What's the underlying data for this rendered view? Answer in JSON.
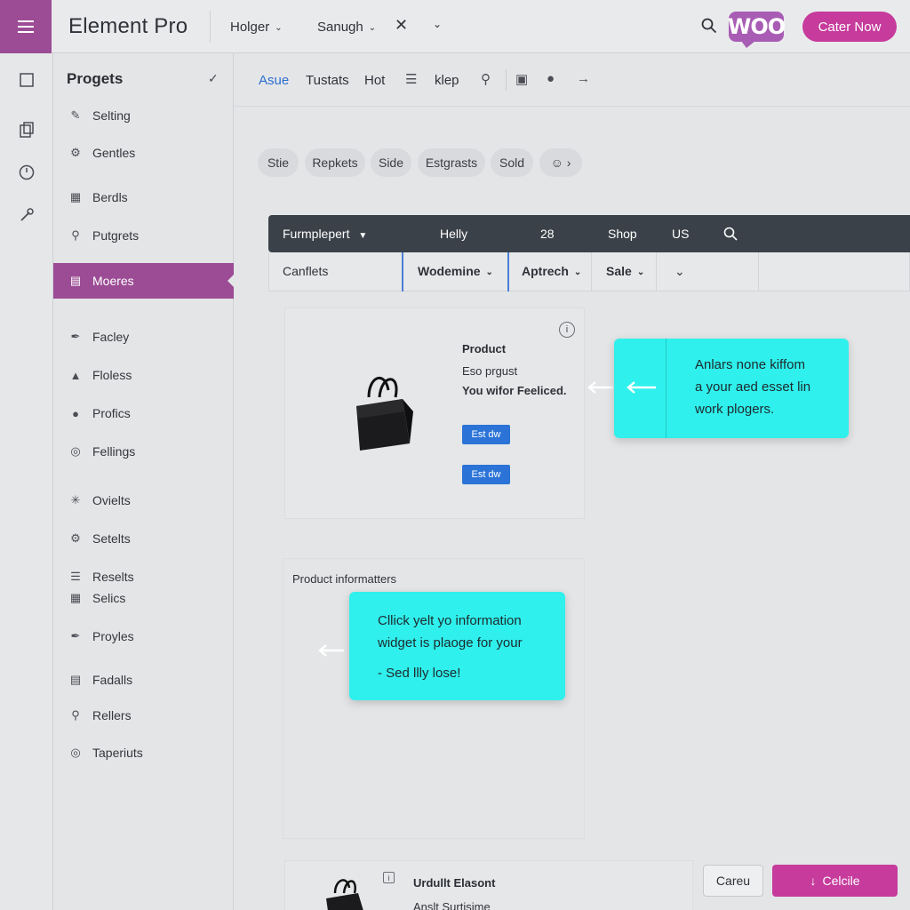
{
  "app": {
    "title": "Element Pro"
  },
  "topbar": {
    "menus": [
      "Holger",
      "Sanugh"
    ],
    "logo_text": "WOO",
    "cta_label": "Cater Now"
  },
  "sidebar": {
    "heading": "Progets",
    "items": [
      {
        "label": "Selting",
        "icon": "pencil-icon"
      },
      {
        "label": "Gentles",
        "icon": "gear-icon"
      },
      {
        "label": "Berdls",
        "icon": "grid-icon"
      },
      {
        "label": "Putgrets",
        "icon": "pin-icon"
      },
      {
        "label": "Moeres",
        "icon": "folder-icon",
        "active": true
      },
      {
        "label": "Facley",
        "icon": "brush-icon"
      },
      {
        "label": "Floless",
        "icon": "lock-icon"
      },
      {
        "label": "Profics",
        "icon": "user-icon"
      },
      {
        "label": "Fellings",
        "icon": "globe-icon"
      },
      {
        "label": "Ovielts",
        "icon": "network-icon"
      },
      {
        "label": "Setelts",
        "icon": "cog-icon"
      },
      {
        "label": "Reselts",
        "icon": "list-icon"
      },
      {
        "label": "Selics",
        "icon": "table-icon"
      },
      {
        "label": "Proyles",
        "icon": "pen-icon"
      },
      {
        "label": "Fadalls",
        "icon": "folder-open-icon"
      },
      {
        "label": "Rellers",
        "icon": "search-icon"
      },
      {
        "label": "Taperiuts",
        "icon": "globe-icon"
      }
    ]
  },
  "toolbar": {
    "tabs": [
      "Asue",
      "Tustats",
      "Hot"
    ],
    "help_label": "klep"
  },
  "chips": [
    "Stie",
    "Repkets",
    "Side",
    "Estgrasts",
    "Sold"
  ],
  "filterbar": {
    "dropdown": "Furmplepert",
    "cells": [
      "Helly",
      "28",
      "Shop",
      "US"
    ]
  },
  "subbar": {
    "cells": [
      "Canflets",
      "Wodemine",
      "Aptrech",
      "Sale"
    ]
  },
  "product": {
    "title": "Product",
    "line1": "Eso prgust",
    "line2": "You wifor Feeliced.",
    "btn1": "Est dw",
    "btn2": "Est dw",
    "info": "i"
  },
  "callout1": {
    "lines": [
      "Anlars none kiffom",
      "a your aed esset lin",
      "work plogers."
    ]
  },
  "section": {
    "label": "Product informatters"
  },
  "callout2": {
    "lines": [
      "Cllick yelt yo information",
      "widget is plaoge for your",
      "- Sed llly lose!"
    ]
  },
  "bottom": {
    "title": "Urdullt Elasont",
    "subtitle": "Anslt Surtisime",
    "cancel_label": "Careu",
    "primary_label": "Celcile",
    "info": "i"
  },
  "colors": {
    "brand_purple": "#9b4c94",
    "cta_magenta": "#c63b9c",
    "callout_cyan": "#2ff0ec",
    "filterbar_dark": "#3a4148",
    "active_blue": "#2d6fd1"
  }
}
